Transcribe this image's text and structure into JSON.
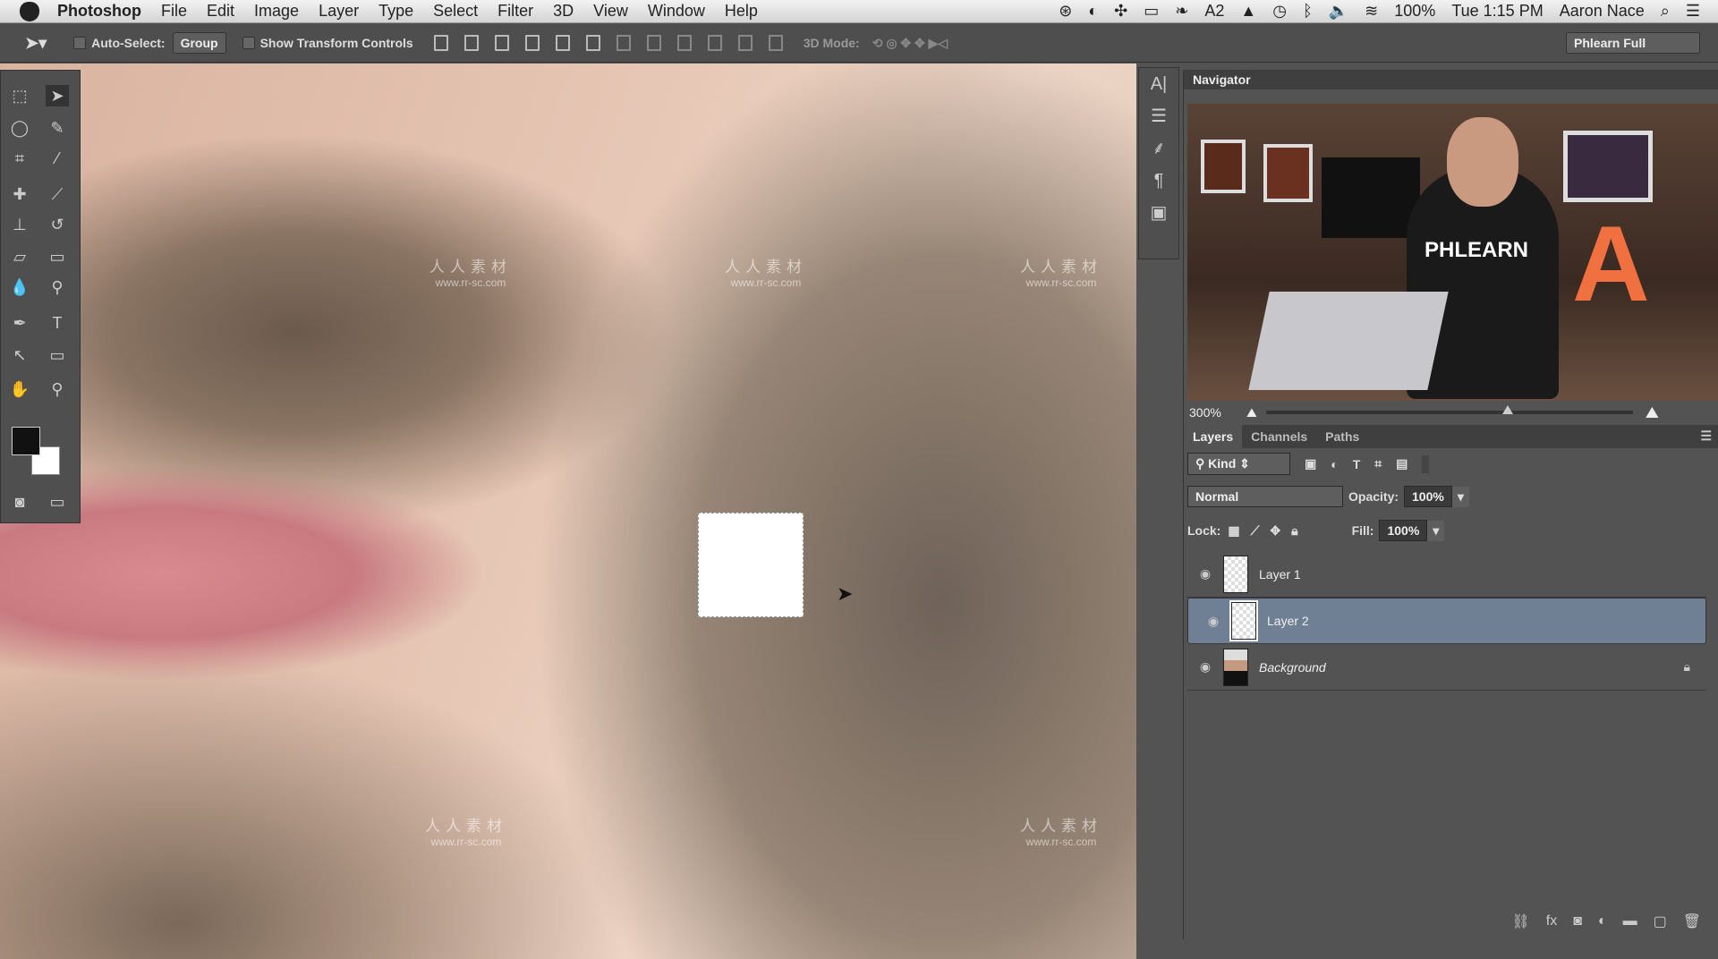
{
  "menubar": {
    "app": "Photoshop",
    "items": [
      "File",
      "Edit",
      "Image",
      "Layer",
      "Type",
      "Select",
      "Filter",
      "3D",
      "View",
      "Window",
      "Help"
    ],
    "status": {
      "ai_badge": "2",
      "battery": "100%",
      "clock": "Tue 1:15 PM",
      "user": "Aaron Nace"
    }
  },
  "options": {
    "auto_select": "Auto-Select:",
    "auto_select_value": "Group",
    "show_transform": "Show Transform Controls",
    "mode_3d": "3D Mode:",
    "workspace": "Phlearn Full"
  },
  "canvas": {
    "watermark_cn": "人人素材",
    "watermark_url": "www.rr-sc.com"
  },
  "navigator": {
    "title": "Navigator",
    "zoom": "300%",
    "zoom_slider_fraction": 0.66,
    "preview_text": "PHLEARN"
  },
  "layers": {
    "tabs": [
      "Layers",
      "Channels",
      "Paths"
    ],
    "filter": "Kind",
    "blend_mode": "Normal",
    "opacity_label": "Opacity:",
    "opacity": "100%",
    "lock_label": "Lock:",
    "fill_label": "Fill:",
    "fill": "100%",
    "items": [
      {
        "name": "Layer 1",
        "selected": false
      },
      {
        "name": "Layer 2",
        "selected": true
      },
      {
        "name": "Background",
        "selected": false,
        "locked": true
      }
    ]
  }
}
